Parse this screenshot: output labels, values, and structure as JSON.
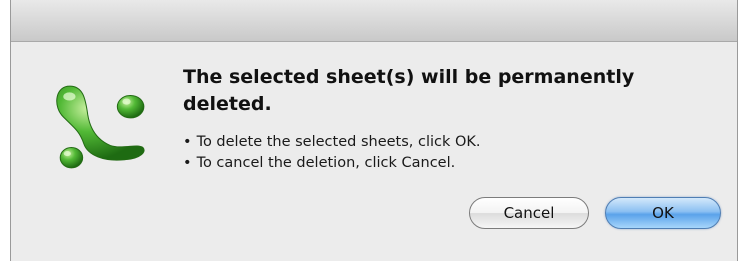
{
  "dialog": {
    "title": "The selected sheet(s) will be permanently deleted.",
    "bullets": [
      "To delete the selected sheets, click OK.",
      "To cancel the deletion, click Cancel."
    ],
    "icon": "excel-app-icon"
  },
  "buttons": {
    "cancel_label": "Cancel",
    "ok_label": "OK"
  },
  "colors": {
    "icon_green": "#3aa52a",
    "default_button": "#5aa2ea"
  }
}
